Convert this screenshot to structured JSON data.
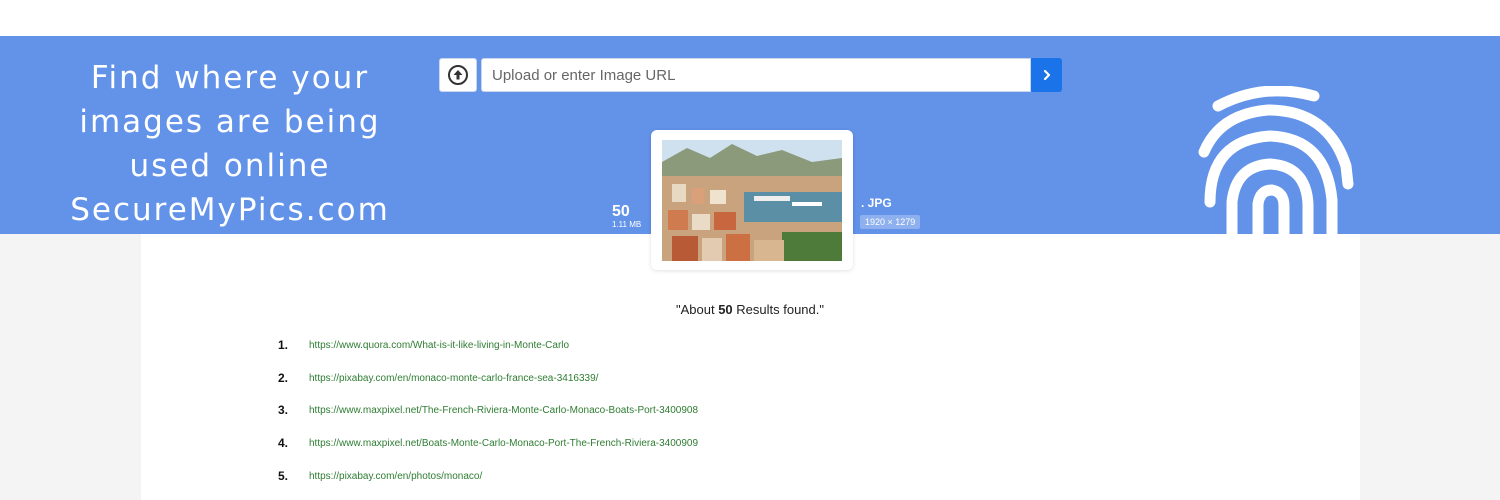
{
  "banner": {
    "tagline_lines": [
      "Find where your",
      "images are being",
      "used online",
      "SecureMyPics.com"
    ],
    "color": "#6293e9"
  },
  "search": {
    "placeholder": "Upload or enter Image URL",
    "value": "",
    "upload_icon": "upload-arrow-icon",
    "submit_icon": "chevron-right-icon",
    "accent": "#1a73e8"
  },
  "image_info": {
    "result_count": "50",
    "file_size": "1.11 MB",
    "extension": ". JPG",
    "dimensions": "1920 × 1279"
  },
  "results": {
    "prefix": "\"About ",
    "count": "50",
    "suffix": " Results found.\"",
    "items": [
      {
        "num": "1.",
        "url": "https://www.quora.com/What-is-it-like-living-in-Monte-Carlo"
      },
      {
        "num": "2.",
        "url": "https://pixabay.com/en/monaco-monte-carlo-france-sea-3416339/"
      },
      {
        "num": "3.",
        "url": "https://www.maxpixel.net/The-French-Riviera-Monte-Carlo-Monaco-Boats-Port-3400908"
      },
      {
        "num": "4.",
        "url": "https://www.maxpixel.net/Boats-Monte-Carlo-Monaco-Port-The-French-Riviera-3400909"
      },
      {
        "num": "5.",
        "url": "https://pixabay.com/en/photos/monaco/"
      }
    ],
    "link_color": "#2e7d32"
  }
}
